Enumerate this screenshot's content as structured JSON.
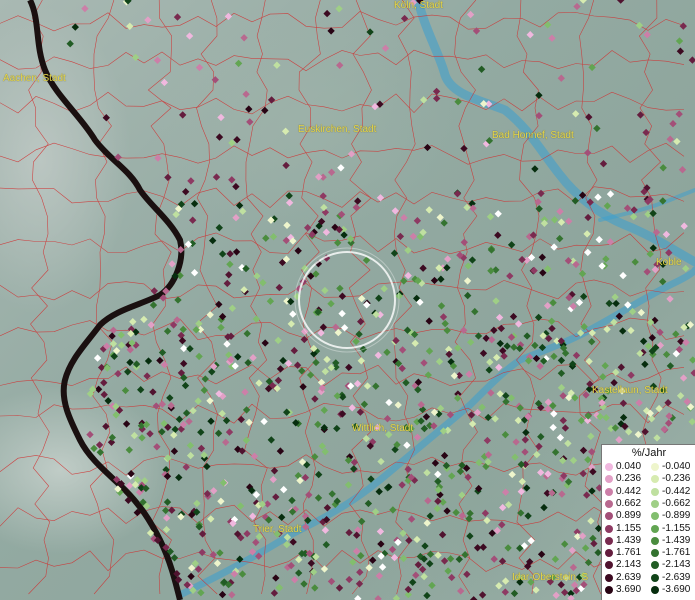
{
  "legend": {
    "title": "%/Jahr",
    "positive": [
      {
        "label": "0.040",
        "color": "#f0b8df"
      },
      {
        "label": "0.236",
        "color": "#e2a0c6"
      },
      {
        "label": "0.442",
        "color": "#cc7fa8"
      },
      {
        "label": "0.662",
        "color": "#b8698f"
      },
      {
        "label": "0.899",
        "color": "#a34f78"
      },
      {
        "label": "1.155",
        "color": "#8e3a63"
      },
      {
        "label": "1.439",
        "color": "#792a4f"
      },
      {
        "label": "1.761",
        "color": "#641d3e"
      },
      {
        "label": "2.143",
        "color": "#50132f"
      },
      {
        "label": "2.639",
        "color": "#3c0a21"
      },
      {
        "label": "3.690",
        "color": "#280414"
      }
    ],
    "negative": [
      {
        "label": "-0.040",
        "color": "#eef5cc"
      },
      {
        "label": "-0.236",
        "color": "#d6ebb0"
      },
      {
        "label": "-0.442",
        "color": "#bfe0a0"
      },
      {
        "label": "-0.662",
        "color": "#9fcf86"
      },
      {
        "label": "-0.899",
        "color": "#82be6e"
      },
      {
        "label": "-1.155",
        "color": "#62a552"
      },
      {
        "label": "-1.439",
        "color": "#4a8c3e"
      },
      {
        "label": "-1.761",
        "color": "#347330"
      },
      {
        "label": "-2.143",
        "color": "#215c24"
      },
      {
        "label": "-2.639",
        "color": "#114419"
      },
      {
        "label": "-3.690",
        "color": "#062d0e"
      }
    ]
  },
  "places": [
    {
      "name": "Köln, Stadt"
    },
    {
      "name": "Aachen, Stadt"
    },
    {
      "name": "Euskirchen, Stadt"
    },
    {
      "name": "Bad Honnef, Stadt"
    },
    {
      "name": "Koble"
    },
    {
      "name": "Kastellaun, Stadt"
    },
    {
      "name": "Wittlich, Stadt"
    },
    {
      "name": "Trier, Stadt"
    },
    {
      "name": "Idar-Oberstein, S"
    }
  ],
  "colors": {
    "district_borders": "#d03030",
    "state_border": "#1a1010",
    "rivers": "#3a9fd0",
    "white_points": "#ffffff",
    "place_labels": "#e8d84a"
  }
}
